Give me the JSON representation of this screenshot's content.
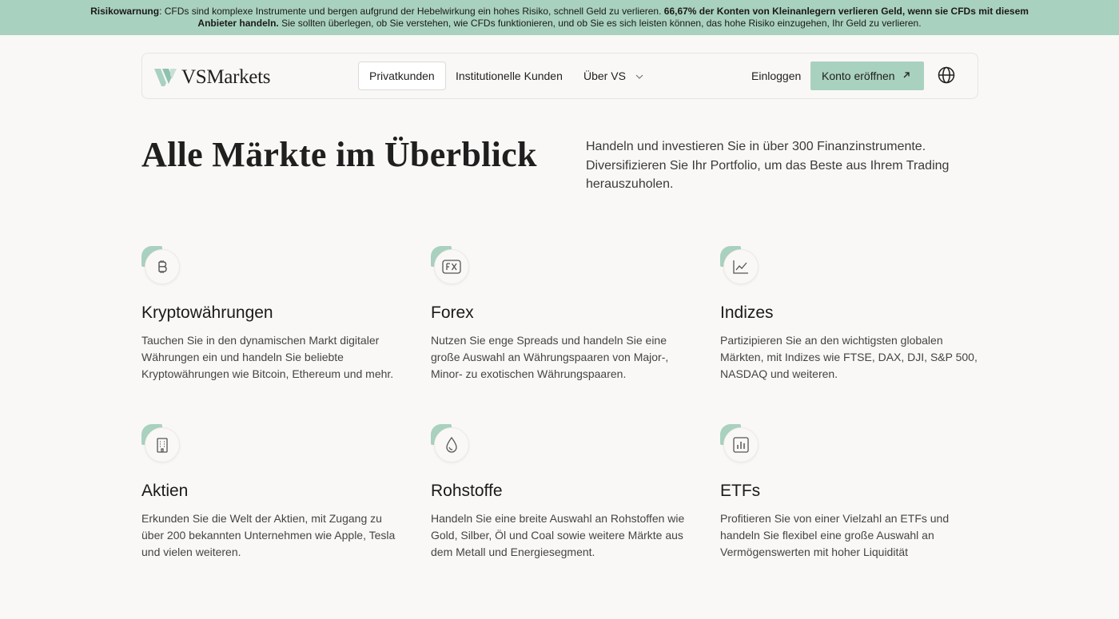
{
  "risk_banner": {
    "prefix_bold": "Risikowarnung",
    "text_1": ": CFDs sind komplexe Instrumente und bergen aufgrund der Hebelwirkung ein hohes Risiko, schnell Geld zu verlieren. ",
    "bold_2": "66,67% der Konten von Kleinanlegern verlieren Geld, wenn sie CFDs mit diesem Anbieter handeln.",
    "text_2": " Sie sollten überlegen, ob Sie verstehen, wie CFDs funktionieren, und ob Sie es sich leisten können, das hohe Risiko einzugehen, Ihr Geld zu verlieren."
  },
  "nav": {
    "logo_text": "VSMarkets",
    "items": [
      {
        "label": "Privatkunden",
        "active": true
      },
      {
        "label": "Institutionelle Kunden",
        "active": false
      },
      {
        "label": "Über VS",
        "active": false
      }
    ],
    "login": "Einloggen",
    "open_account": "Konto eröffnen",
    "language_icon": "globe-icon"
  },
  "hero": {
    "title": "Alle Märkte im Überblick",
    "description": "Handeln und investieren Sie in über 300 Finanzinstrumente. Diversifizieren Sie Ihr Portfolio, um das Beste aus Ihrem Trading herauszuholen."
  },
  "markets": [
    {
      "icon": "bitcoin-icon",
      "title": "Kryptowährungen",
      "text": "Tauchen Sie in den dynamischen Markt digitaler Währungen ein und handeln Sie beliebte Kryptowährungen wie Bitcoin, Ethereum und mehr."
    },
    {
      "icon": "fx-icon",
      "title": "Forex",
      "text": "Nutzen Sie enge Spreads und handeln Sie eine große Auswahl an Währungspaaren von Major-, Minor- zu exotischen Währungspaaren."
    },
    {
      "icon": "line-chart-icon",
      "title": "Indizes",
      "text": "Partizipieren Sie an den wichtigsten globalen Märkten, mit Indizes wie FTSE, DAX, DJI, S&P 500, NASDAQ und weiteren."
    },
    {
      "icon": "building-icon",
      "title": "Aktien",
      "text": "Erkunden Sie die Welt der Aktien, mit Zugang zu über 200 bekannten Unternehmen wie Apple, Tesla und vielen weiteren."
    },
    {
      "icon": "drop-icon",
      "title": "Rohstoffe",
      "text": "Handeln Sie eine breite Auswahl an Rohstoffen wie Gold, Silber, Öl und Coal sowie weitere Märkte aus dem Metall und Energiesegment."
    },
    {
      "icon": "bar-chart-icon",
      "title": "ETFs",
      "text": "Profitieren Sie von einer Vielzahl an ETFs und handeln Sie flexibel eine große Auswahl an Vermögenswerten mit hoher Liquidität"
    }
  ],
  "colors": {
    "accent": "#a9d1bf",
    "background": "#faf8f6",
    "text": "#1f1f1f"
  }
}
